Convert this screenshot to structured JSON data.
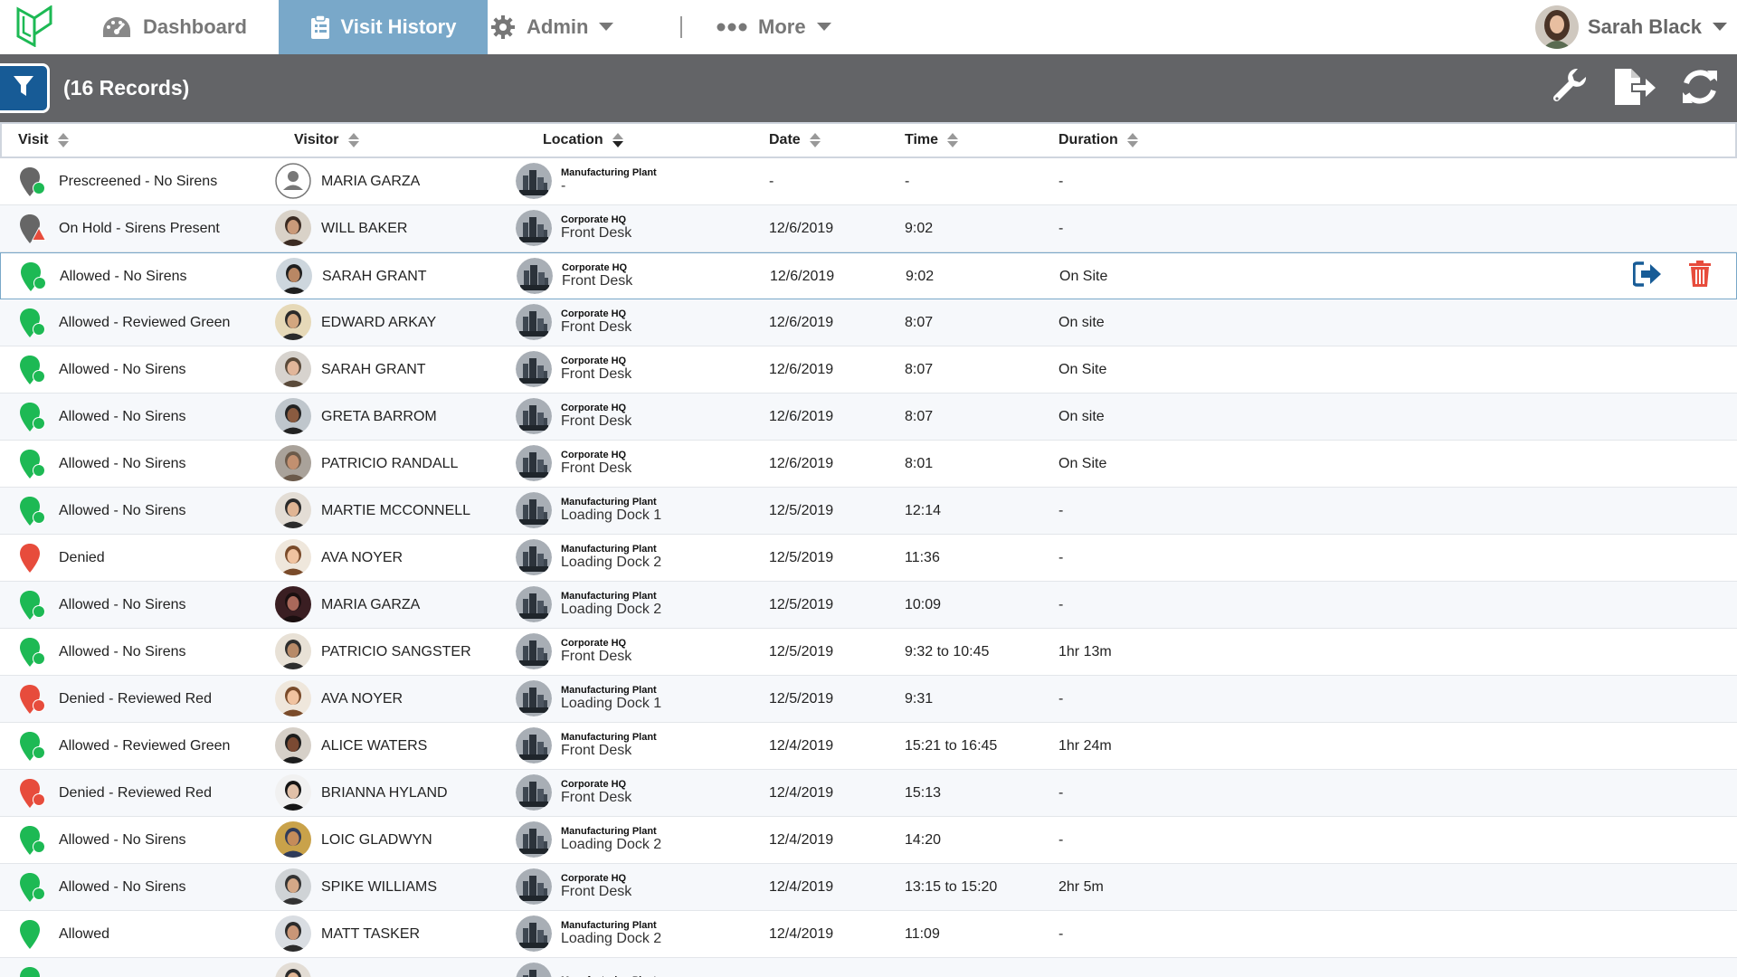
{
  "nav": {
    "dashboard": "Dashboard",
    "visit_history": "Visit History",
    "admin": "Admin",
    "more": "More",
    "user_name": "Sarah Black"
  },
  "toolbar": {
    "records": "(16 Records)"
  },
  "table": {
    "headers": {
      "visit": "Visit",
      "visitor": "Visitor",
      "location": "Location",
      "date": "Date",
      "time": "Time",
      "duration": "Duration"
    },
    "rows": [
      {
        "status": "prescreened",
        "visit": "Prescreened - No Sirens",
        "avatar": "placeholder",
        "visitor": "MARIA GARZA",
        "site": "Manufacturing Plant",
        "area": "-",
        "date": "-",
        "time": "-",
        "duration": "-"
      },
      {
        "status": "onhold",
        "visit": "On Hold - Sirens Present",
        "avatar": "c1",
        "visitor": "WILL BAKER",
        "site": "Corporate HQ",
        "area": "Front Desk",
        "date": "12/6/2019",
        "time": "9:02",
        "duration": "-"
      },
      {
        "status": "allowed",
        "visit": "Allowed - No Sirens",
        "avatar": "c2",
        "visitor": "SARAH GRANT",
        "site": "Corporate HQ",
        "area": "Front Desk",
        "date": "12/6/2019",
        "time": "9:02",
        "duration": "On Site"
      },
      {
        "status": "allowed",
        "visit": "Allowed - Reviewed Green",
        "avatar": "c3",
        "visitor": "EDWARD ARKAY",
        "site": "Corporate HQ",
        "area": "Front Desk",
        "date": "12/6/2019",
        "time": "8:07",
        "duration": "On site"
      },
      {
        "status": "allowed",
        "visit": "Allowed - No Sirens",
        "avatar": "c4",
        "visitor": "SARAH GRANT",
        "site": "Corporate HQ",
        "area": "Front Desk",
        "date": "12/6/2019",
        "time": "8:07",
        "duration": "On Site"
      },
      {
        "status": "allowed",
        "visit": "Allowed - No Sirens",
        "avatar": "c5",
        "visitor": "GRETA BARROM",
        "site": "Corporate HQ",
        "area": "Front Desk",
        "date": "12/6/2019",
        "time": "8:07",
        "duration": "On site"
      },
      {
        "status": "allowed",
        "visit": "Allowed - No Sirens",
        "avatar": "c6",
        "visitor": "PATRICIO RANDALL",
        "site": "Corporate HQ",
        "area": "Front Desk",
        "date": "12/6/2019",
        "time": "8:01",
        "duration": "On Site"
      },
      {
        "status": "allowed",
        "visit": "Allowed - No Sirens",
        "avatar": "c7",
        "visitor": "MARTIE MCCONNELL",
        "site": "Manufacturing Plant",
        "area": "Loading Dock 1",
        "date": "12/5/2019",
        "time": "12:14",
        "duration": "-"
      },
      {
        "status": "denied",
        "visit": "Denied",
        "avatar": "c8",
        "visitor": "AVA NOYER",
        "site": "Manufacturing Plant",
        "area": "Loading Dock 2",
        "date": "12/5/2019",
        "time": "11:36",
        "duration": "-"
      },
      {
        "status": "allowed",
        "visit": "Allowed - No Sirens",
        "avatar": "c9",
        "visitor": "MARIA GARZA",
        "site": "Manufacturing Plant",
        "area": "Loading Dock 2",
        "date": "12/5/2019",
        "time": "10:09",
        "duration": "-"
      },
      {
        "status": "allowed",
        "visit": "Allowed - No Sirens",
        "avatar": "c10",
        "visitor": "PATRICIO SANGSTER",
        "site": "Corporate HQ",
        "area": "Front Desk",
        "date": "12/5/2019",
        "time": "9:32 to 10:45",
        "duration": "1hr 13m"
      },
      {
        "status": "deniedred",
        "visit": "Denied - Reviewed Red",
        "avatar": "c8",
        "visitor": "AVA NOYER",
        "site": "Manufacturing Plant",
        "area": "Loading Dock 1",
        "date": "12/5/2019",
        "time": "9:31",
        "duration": "-"
      },
      {
        "status": "allowed",
        "visit": "Allowed - Reviewed Green",
        "avatar": "c11",
        "visitor": "ALICE WATERS",
        "site": "Manufacturing Plant",
        "area": "Front Desk",
        "date": "12/4/2019",
        "time": "15:21 to 16:45",
        "duration": "1hr 24m"
      },
      {
        "status": "deniedred",
        "visit": "Denied - Reviewed Red",
        "avatar": "c12",
        "visitor": "BRIANNA HYLAND",
        "site": "Corporate HQ",
        "area": "Front Desk",
        "date": "12/4/2019",
        "time": "15:13",
        "duration": "-"
      },
      {
        "status": "allowed",
        "visit": "Allowed - No Sirens",
        "avatar": "c13",
        "visitor": "LOIC GLADWYN",
        "site": "Manufacturing Plant",
        "area": "Loading Dock 2",
        "date": "12/4/2019",
        "time": "14:20",
        "duration": "-"
      },
      {
        "status": "allowed",
        "visit": "Allowed - No Sirens",
        "avatar": "c14",
        "visitor": "SPIKE WILLIAMS",
        "site": "Corporate HQ",
        "area": "Front Desk",
        "date": "12/4/2019",
        "time": "13:15 to 15:20",
        "duration": "2hr 5m"
      },
      {
        "status": "allowedplain",
        "visit": "Allowed",
        "avatar": "c15",
        "visitor": "MATT TASKER",
        "site": "Manufacturing Plant",
        "area": "Loading Dock 2",
        "date": "12/4/2019",
        "time": "11:09",
        "duration": "-"
      },
      {
        "status": "allowed",
        "visit": "",
        "avatar": "c7",
        "visitor": "",
        "site": "Manufacturing Plant",
        "area": "",
        "date": "",
        "time": "",
        "duration": ""
      }
    ]
  },
  "colors": {
    "nav_active": "#79a8c9",
    "toolbar": "#636467",
    "filter_button": "#175b96",
    "status_green": "#1db954",
    "status_red": "#e74c3c",
    "status_gray": "#666666",
    "action_blue": "#175b96",
    "action_red": "#e74c3c"
  },
  "selected_row_actions": {
    "checkout_icon": "sign-out-icon",
    "delete_icon": "trash-icon"
  }
}
